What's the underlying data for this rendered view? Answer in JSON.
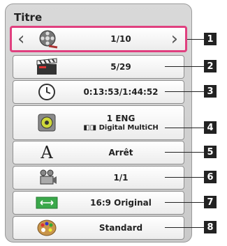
{
  "title": "Titre",
  "rows": [
    {
      "value": "1/10",
      "icon": "film-reel-icon"
    },
    {
      "value": "5/29",
      "icon": "clapperboard-icon"
    },
    {
      "value": "0:13:53/1:44:52",
      "icon": "clock-icon"
    },
    {
      "value": "1 ENG",
      "sub": "Digital MultiCH",
      "icon": "speaker-icon"
    },
    {
      "value": "Arrêt",
      "icon": "subtitle-a-icon"
    },
    {
      "value": "1/1",
      "icon": "camera-angle-icon"
    },
    {
      "value": "16:9 Original",
      "icon": "aspect-ratio-icon"
    },
    {
      "value": "Standard",
      "icon": "picture-mode-palette-icon"
    }
  ],
  "numbers": [
    "1",
    "2",
    "3",
    "4",
    "5",
    "6",
    "7",
    "8"
  ],
  "colors": {
    "highlight": "#e0407f",
    "label_bg": "#222222"
  }
}
